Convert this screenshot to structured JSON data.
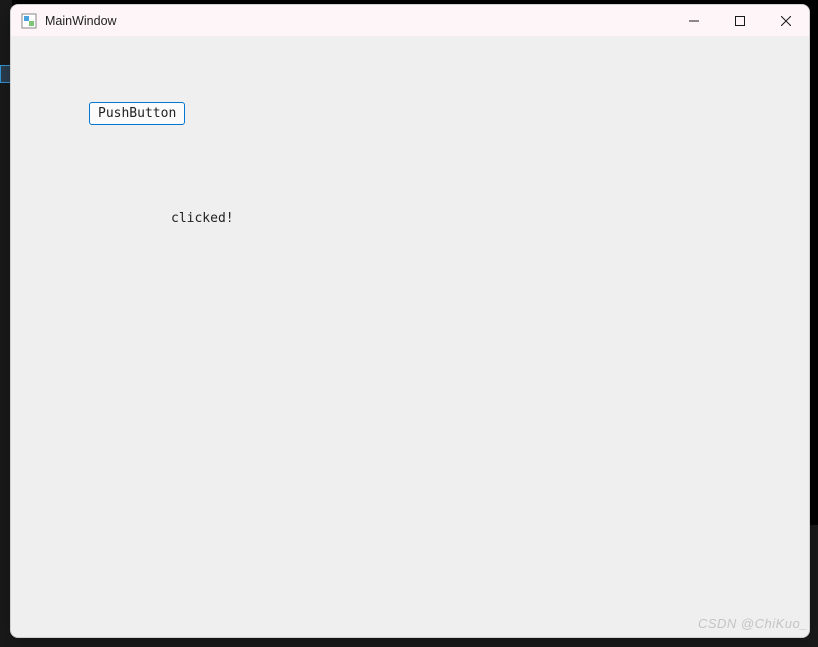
{
  "window": {
    "title": "MainWindow"
  },
  "content": {
    "button_label": "PushButton",
    "status_text": "clicked!"
  },
  "watermark": "CSDN @ChiKuo_"
}
